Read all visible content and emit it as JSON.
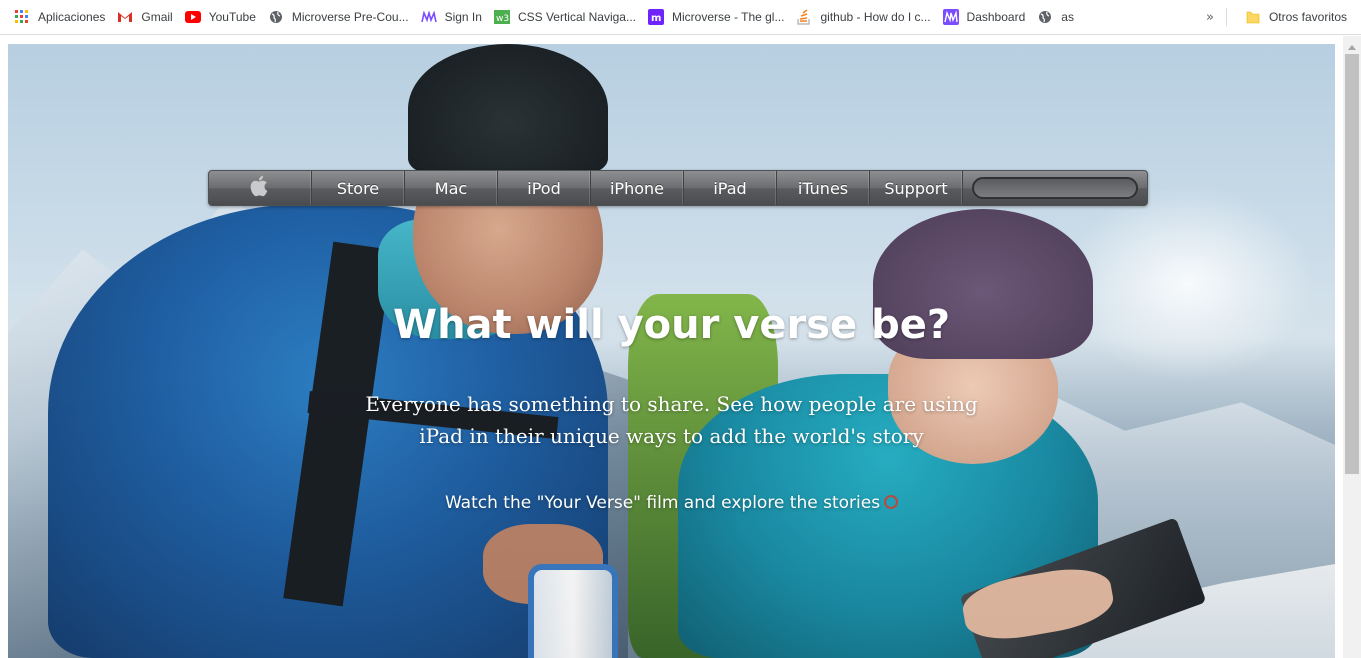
{
  "bookmarks": {
    "items": [
      {
        "label": "Aplicaciones",
        "icon": "apps-grid-icon"
      },
      {
        "label": "Gmail",
        "icon": "gmail-icon"
      },
      {
        "label": "YouTube",
        "icon": "youtube-icon"
      },
      {
        "label": "Microverse Pre-Cou...",
        "icon": "globe-icon"
      },
      {
        "label": "Sign In",
        "icon": "microverse-icon"
      },
      {
        "label": "CSS Vertical Naviga...",
        "icon": "w3-icon"
      },
      {
        "label": "Microverse - The gl...",
        "icon": "microverse-m-icon"
      },
      {
        "label": "github - How do I c...",
        "icon": "stackoverflow-icon"
      },
      {
        "label": "Dashboard",
        "icon": "microverse-icon"
      },
      {
        "label": "as",
        "icon": "globe-icon"
      }
    ],
    "overflow_label": "»",
    "other_label": "Otros favoritos"
  },
  "nav": {
    "apple_glyph": "",
    "items": [
      "Store",
      "Mac",
      "iPod",
      "iPhone",
      "iPad",
      "iTunes",
      "Support"
    ],
    "search_placeholder": ""
  },
  "hero": {
    "title": "What will your verse be?",
    "subtitle": "Everyone has something to share. See how people are using iPad in their unique ways to add the world's story",
    "link": "Watch the \"Your Verse\" film and explore the stories"
  }
}
